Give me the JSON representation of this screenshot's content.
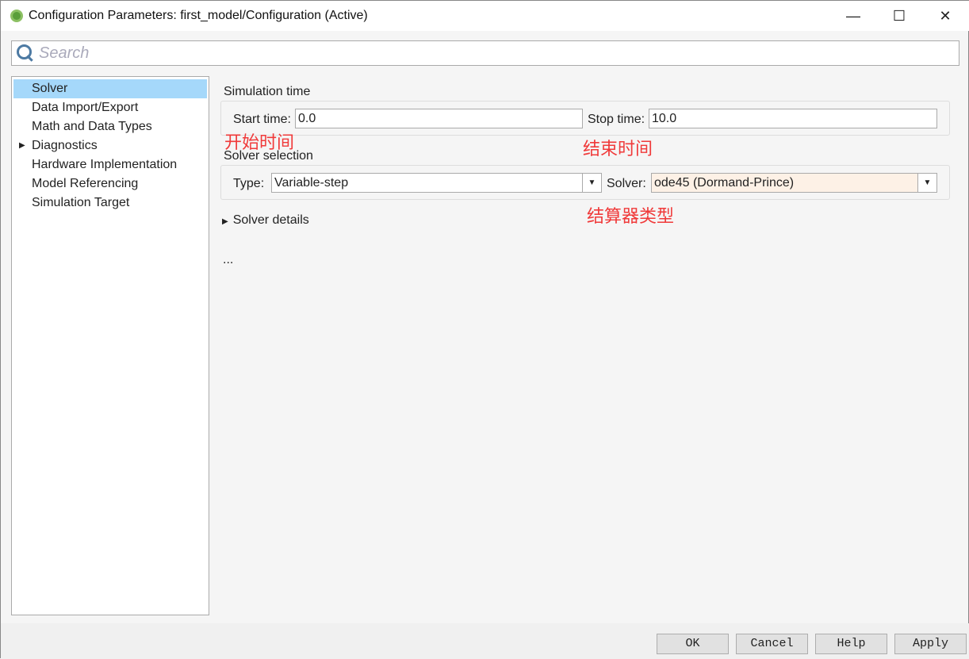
{
  "window": {
    "title": "Configuration Parameters: first_model/Configuration (Active)",
    "minimize": "—",
    "maximize": "☐",
    "close": "✕"
  },
  "search": {
    "placeholder": "Search"
  },
  "sidebar": {
    "items": [
      {
        "label": "Solver",
        "selected": true
      },
      {
        "label": "Data Import/Export"
      },
      {
        "label": "Math and Data Types"
      },
      {
        "label": "Diagnostics",
        "expandable": true
      },
      {
        "label": "Hardware Implementation"
      },
      {
        "label": "Model Referencing"
      },
      {
        "label": "Simulation Target"
      }
    ]
  },
  "simulation_time": {
    "heading": "Simulation time",
    "start_label": "Start time:",
    "start_value": "0.0",
    "stop_label": "Stop time:",
    "stop_value": "10.0"
  },
  "solver_selection": {
    "heading": "Solver selection",
    "type_label": "Type:",
    "type_value": "Variable-step",
    "solver_label": "Solver:",
    "solver_value": "ode45 (Dormand-Prince)"
  },
  "solver_details": {
    "label": "Solver details"
  },
  "ellipsis": "...",
  "annotations": {
    "start": "开始时间",
    "stop": "结束时间",
    "solver": "结算器类型",
    "color": "#f03a3a"
  },
  "footer": {
    "ok": "OK",
    "cancel": "Cancel",
    "help": "Help",
    "apply": "Apply"
  }
}
